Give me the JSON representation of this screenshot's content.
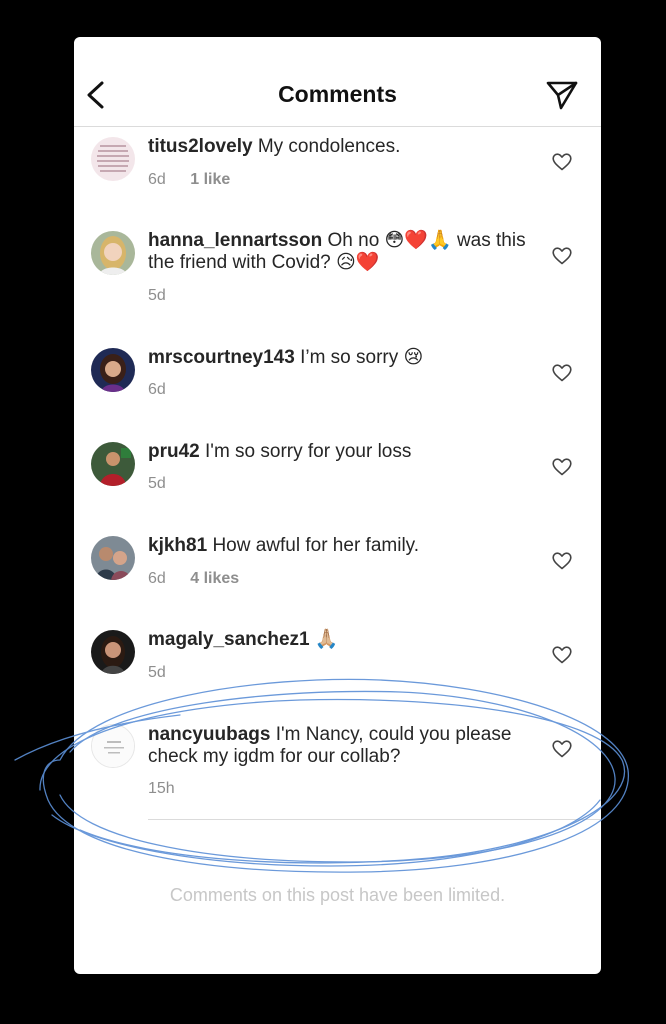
{
  "header": {
    "title": "Comments"
  },
  "comments": [
    {
      "username": "titus2lovely",
      "text": "My condolences.",
      "time": "6d",
      "likes": "1 like"
    },
    {
      "username": "hanna_lennartsson",
      "text": "Oh no 😳❤️🙏 was this the friend with Covid? 😥❤️",
      "time": "5d",
      "likes": ""
    },
    {
      "username": "mrscourtney143",
      "text": "I’m so sorry 😢",
      "time": "6d",
      "likes": ""
    },
    {
      "username": "pru42",
      "text": "I'm so sorry for your loss",
      "time": "5d",
      "likes": ""
    },
    {
      "username": "kjkh81",
      "text": "How awful for her family.",
      "time": "6d",
      "likes": "4 likes"
    },
    {
      "username": "magaly_sanchez1",
      "text": "🙏🏼",
      "time": "5d",
      "likes": ""
    },
    {
      "username": "nancyuubags",
      "text": "I'm Nancy, could you please check my igdm for our collab?",
      "time": "15h",
      "likes": ""
    }
  ],
  "footer": {
    "text": "Comments on this post have been limited."
  },
  "icons": {
    "back": "chevron-left-icon",
    "send": "paper-plane-icon",
    "like": "heart-outline-icon"
  },
  "colors": {
    "annotation": "#5b8fd6",
    "secondary_text": "#8e8e8e",
    "limited_text": "#c7c7c7"
  }
}
